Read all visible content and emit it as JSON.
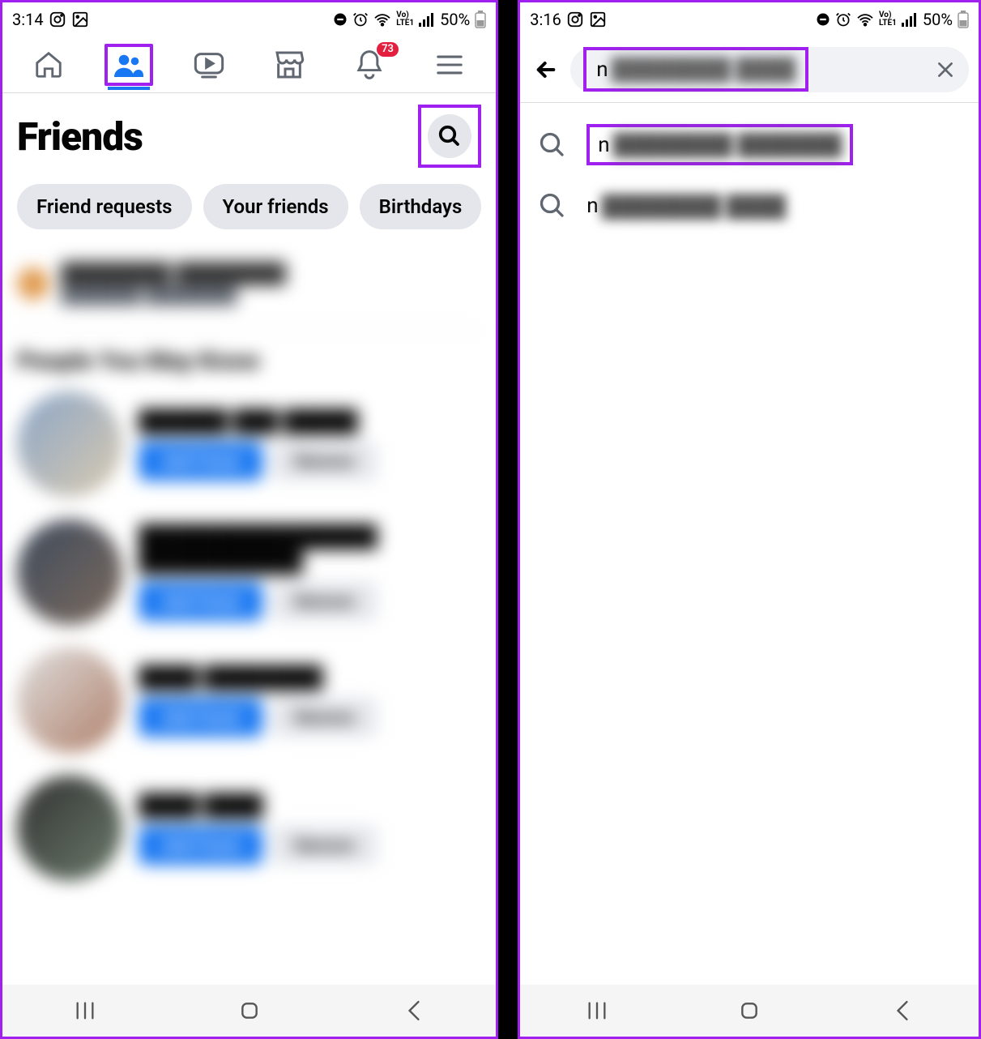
{
  "left_pane": {
    "status": {
      "time": "3:14",
      "battery_text": "50%"
    },
    "nav": {
      "badge_count": "73"
    },
    "page_title": "Friends",
    "pills": [
      "Friend requests",
      "Your friends",
      "Birthdays"
    ],
    "activity": {
      "name": "████████ ████████",
      "sub": "███████ ████████"
    },
    "section_heading": "People You May Know",
    "suggestions": [
      {
        "name": "██████ ███ █████",
        "primary": "Add Friend",
        "secondary": "Remove"
      },
      {
        "name": "████████████████ ███████████",
        "primary": "Add Friend",
        "secondary": "Remove"
      },
      {
        "name": "████ ████████",
        "primary": "Add Friend",
        "secondary": "Remove"
      },
      {
        "name": "████ ████",
        "primary": "Add Friend",
        "secondary": "Remove"
      }
    ]
  },
  "right_pane": {
    "status": {
      "time": "3:16",
      "battery_text": "50%"
    },
    "search": {
      "query_visible": "n",
      "query_redacted": "████████ ████"
    },
    "suggestions": [
      {
        "visible": "n",
        "redacted": "████████ ███████",
        "highlighted": true
      },
      {
        "visible": "n",
        "redacted": "████████ ████",
        "highlighted": false
      }
    ]
  }
}
